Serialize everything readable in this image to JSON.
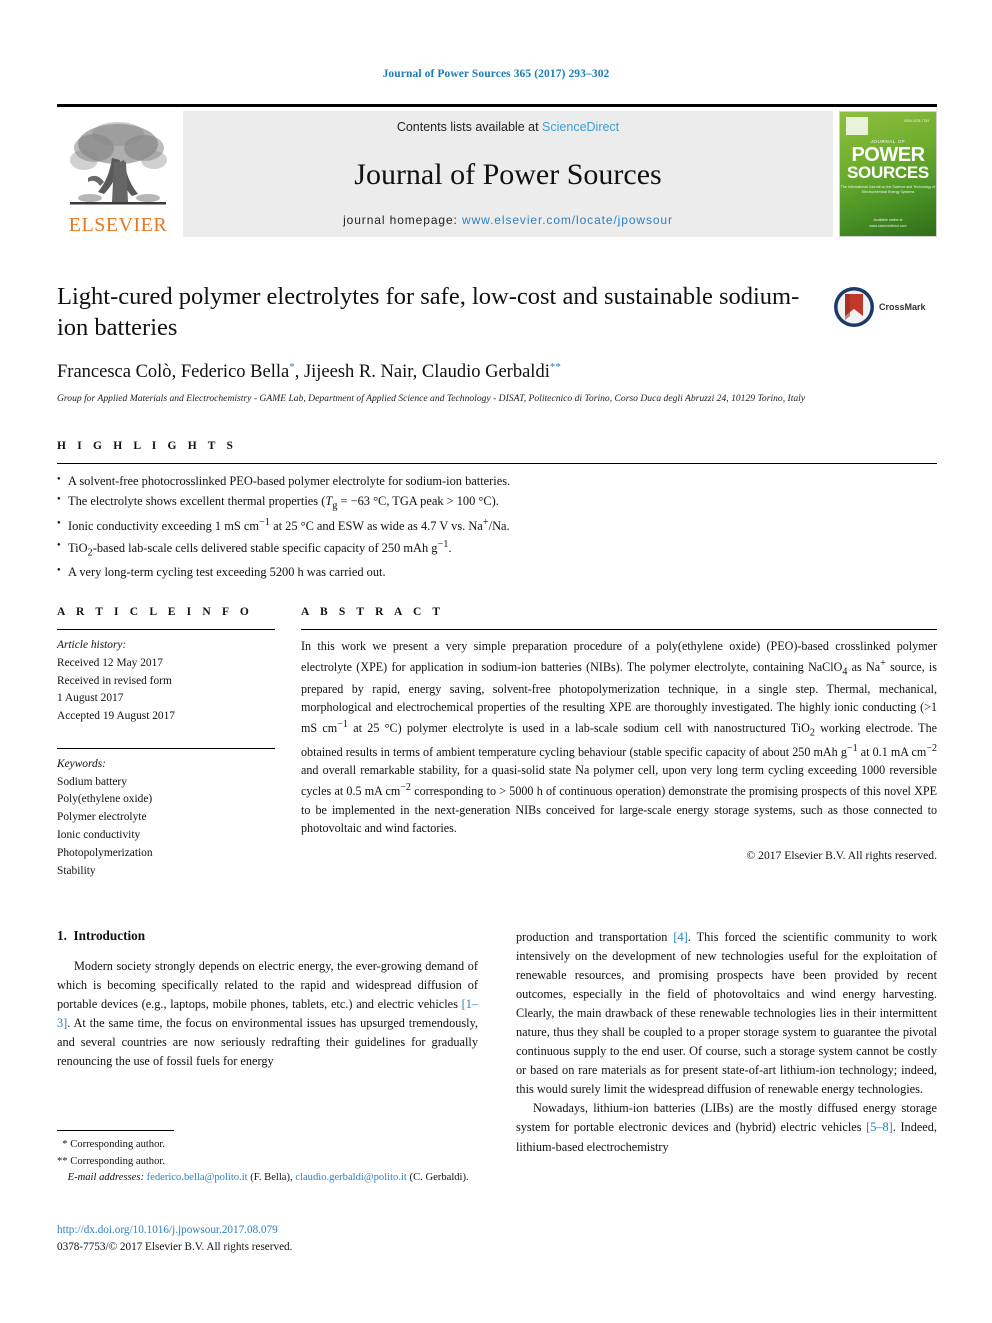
{
  "running_head": "Journal of Power Sources 365 (2017) 293–302",
  "masthead": {
    "publisher_name": "ELSEVIER",
    "publisher_logo_icon": "elsevier-tree-icon",
    "contents_prefix": "Contents lists available at ",
    "contents_link": "ScienceDirect",
    "journal_name": "Journal of Power Sources",
    "homepage_prefix": "journal homepage: ",
    "homepage_url": "www.elsevier.com/locate/jpowsour",
    "cover": {
      "issn_text": "ISSN 0378-7753",
      "kicker": "JOURNAL OF",
      "title_line1": "POWER",
      "title_line2": "SOURCES",
      "subtitle": "The International Journal on the Science and Technology of Electrochemical Energy Systems",
      "footer": "Available online at\nwww.sciencedirect.com"
    }
  },
  "article": {
    "title": "Light-cured polymer electrolytes for safe, low-cost and sustainable sodium-ion batteries",
    "crossmark_label": "CrossMark",
    "affiliation": "Group for Applied Materials and Electrochemistry - GAME Lab, Department of Applied Science and Technology - DISAT, Politecnico di Torino, Corso Duca degli Abruzzi 24, 10129 Torino, Italy"
  },
  "authors": [
    {
      "name": "Francesca Colò",
      "marker": ""
    },
    {
      "name": "Federico Bella",
      "marker": "*"
    },
    {
      "name": "Jijeesh R. Nair",
      "marker": ""
    },
    {
      "name": "Claudio Gerbaldi",
      "marker": "**"
    }
  ],
  "highlights": {
    "heading": "H I G H L I G H T S",
    "items": [
      "A solvent-free photocrosslinked PEO-based polymer electrolyte for sodium-ion batteries.",
      "The electrolyte shows excellent thermal properties (T_g = −63 °C, TGA peak > 100 °C).",
      "Ionic conductivity exceeding 1 mS cm^-1 at 25 °C and ESW as wide as 4.7 V vs. Na+/Na.",
      "TiO2-based lab-scale cells delivered stable specific capacity of 250 mAh g^-1.",
      "A very long-term cycling test exceeding 5200 h was carried out."
    ]
  },
  "article_info": {
    "heading": "A R T I C L E   I N F O",
    "history_label": "Article history:",
    "history": [
      "Received 12 May 2017",
      "Received in revised form",
      "1 August 2017",
      "Accepted 19 August 2017"
    ],
    "keywords_label": "Keywords:",
    "keywords": [
      "Sodium battery",
      "Poly(ethylene oxide)",
      "Polymer electrolyte",
      "Ionic conductivity",
      "Photopolymerization",
      "Stability"
    ]
  },
  "abstract": {
    "heading": "A B S T R A C T",
    "copyright": "© 2017 Elsevier B.V. All rights reserved."
  },
  "introduction": {
    "section_number": "1.",
    "section_title": "Introduction"
  },
  "footnotes": {
    "corresponding_1": "Corresponding author.",
    "corresponding_2": "Corresponding author.",
    "email_label": "E-mail addresses:",
    "email_1": "federico.bella@polito.it",
    "email_1_who": "(F. Bella),",
    "email_2": "claudio.gerbaldi@polito.it",
    "email_2_who": "(C. Gerbaldi)."
  },
  "doi": {
    "url": "http://dx.doi.org/10.1016/j.jpowsour.2017.08.079",
    "issn_line": "0378-7753/© 2017 Elsevier B.V. All rights reserved."
  },
  "colors": {
    "link_blue": "#2b7fc0",
    "running_head_blue": "#1a7dbb",
    "elsevier_orange": "#e87722",
    "band_gray": "#ececec"
  }
}
